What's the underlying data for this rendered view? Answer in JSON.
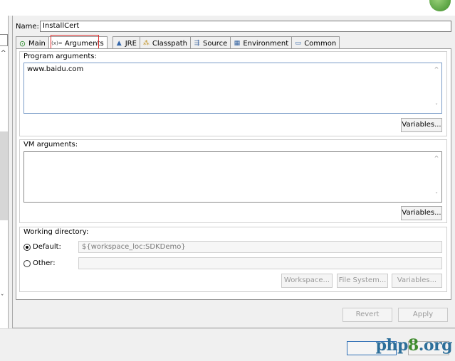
{
  "name": {
    "label": "Name:",
    "value": "InstallCert"
  },
  "tabs": [
    {
      "label": "Main",
      "icon": "main-run-icon"
    },
    {
      "label": "Arguments",
      "icon": "arguments-icon"
    },
    {
      "label": "JRE",
      "icon": "jre-icon"
    },
    {
      "label": "Classpath",
      "icon": "classpath-icon"
    },
    {
      "label": "Source",
      "icon": "source-icon"
    },
    {
      "label": "Environment",
      "icon": "environment-icon"
    },
    {
      "label": "Common",
      "icon": "common-icon"
    }
  ],
  "tab_icon_glyphs": {
    "main": "⊙",
    "arguments": "(x)=",
    "jre": "▲",
    "classpath": "⁂",
    "source": "⇶",
    "environment": "▦",
    "common": "▭"
  },
  "program_args": {
    "label": "Program arguments:",
    "value": "www.baidu.com",
    "variables_label": "Variables..."
  },
  "vm_args": {
    "label": "VM arguments:",
    "value": "",
    "variables_label": "Variables..."
  },
  "working_dir": {
    "label": "Working directory:",
    "default_label": "Default:",
    "default_value": "${workspace_loc:SDKDemo}",
    "other_label": "Other:",
    "other_value": "",
    "workspace_label": "Workspace...",
    "filesystem_label": "File System...",
    "variables_label": "Variables..."
  },
  "actions": {
    "revert_label": "Revert",
    "apply_label": "Apply"
  },
  "watermark": {
    "part1": "php",
    "part2": "8",
    "part3": ".org"
  },
  "scroll_glyphs": {
    "up": "^",
    "down": "ˇ"
  },
  "colors": {
    "tab_highlight": "#e03030",
    "focus_border": "#7a9cc8",
    "watermark_blue": "#2d6f9a",
    "watermark_green": "#3f8b2d"
  }
}
